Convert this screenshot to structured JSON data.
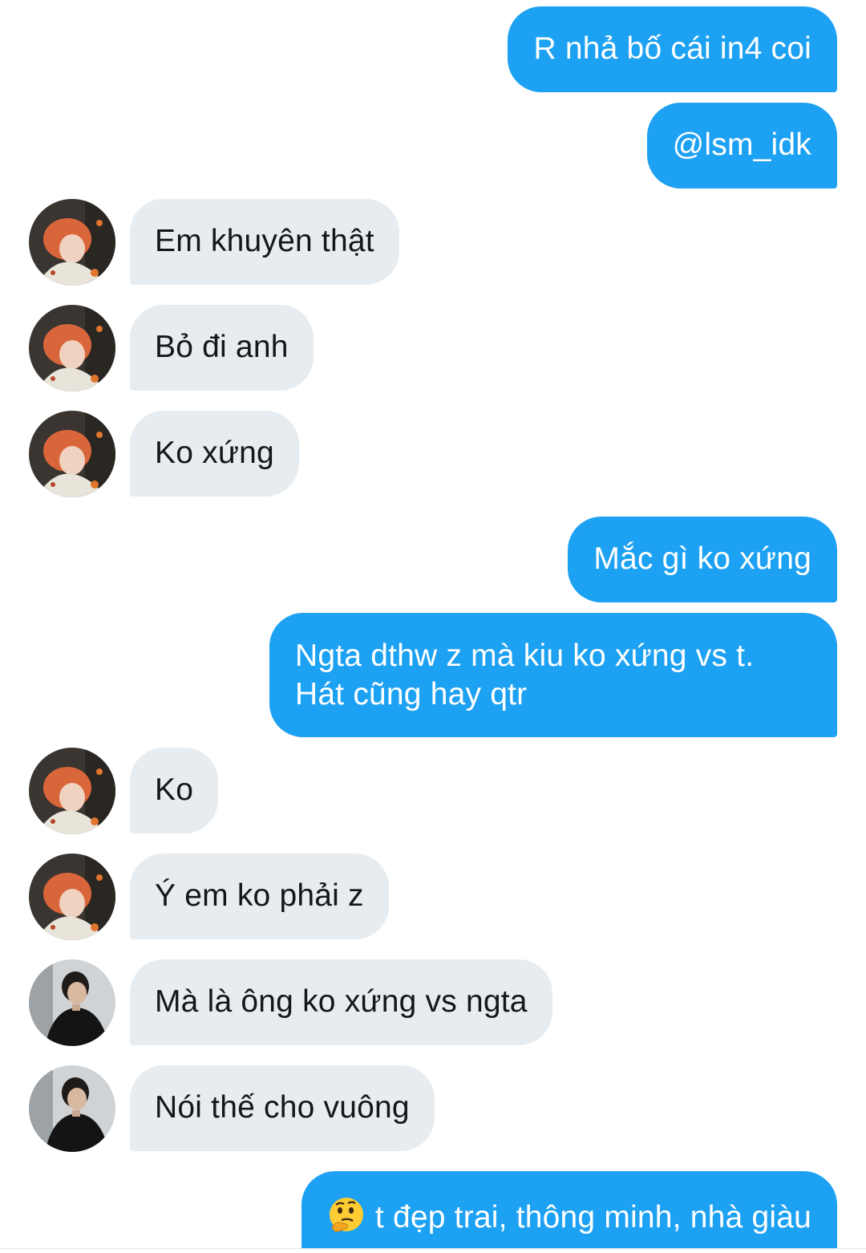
{
  "theme": {
    "outgoing_bubble_color": "#1da1f2",
    "incoming_bubble_color": "#e6ecf0"
  },
  "messages": [
    {
      "sender": "me",
      "text": "R nhả bố cái in4 coi"
    },
    {
      "sender": "me",
      "text": "@lsm_idk"
    },
    {
      "sender": "them",
      "avatar": "avatar-red-hair",
      "text": "Em khuyên thật"
    },
    {
      "sender": "them",
      "avatar": "avatar-red-hair",
      "text": "Bỏ đi anh"
    },
    {
      "sender": "them",
      "avatar": "avatar-red-hair",
      "text": "Ko xứng"
    },
    {
      "sender": "me",
      "text": "Mắc gì ko xứng"
    },
    {
      "sender": "me",
      "lines": [
        "Ngta dthw z mà kiu ko xứng vs t.",
        "Hát cũng hay qtr"
      ]
    },
    {
      "sender": "them",
      "avatar": "avatar-red-hair",
      "text": "Ko"
    },
    {
      "sender": "them",
      "avatar": "avatar-red-hair",
      "text": "Ý em ko phải z"
    },
    {
      "sender": "them",
      "avatar": "avatar-dark-shirt",
      "text": "Mà là ông ko xứng vs ngta"
    },
    {
      "sender": "them",
      "avatar": "avatar-dark-shirt",
      "text": "Nói thế cho vuông"
    },
    {
      "sender": "me",
      "emoji": "thinking-face-emoji",
      "text": "t đẹp trai, thông minh, nhà giàu"
    }
  ]
}
